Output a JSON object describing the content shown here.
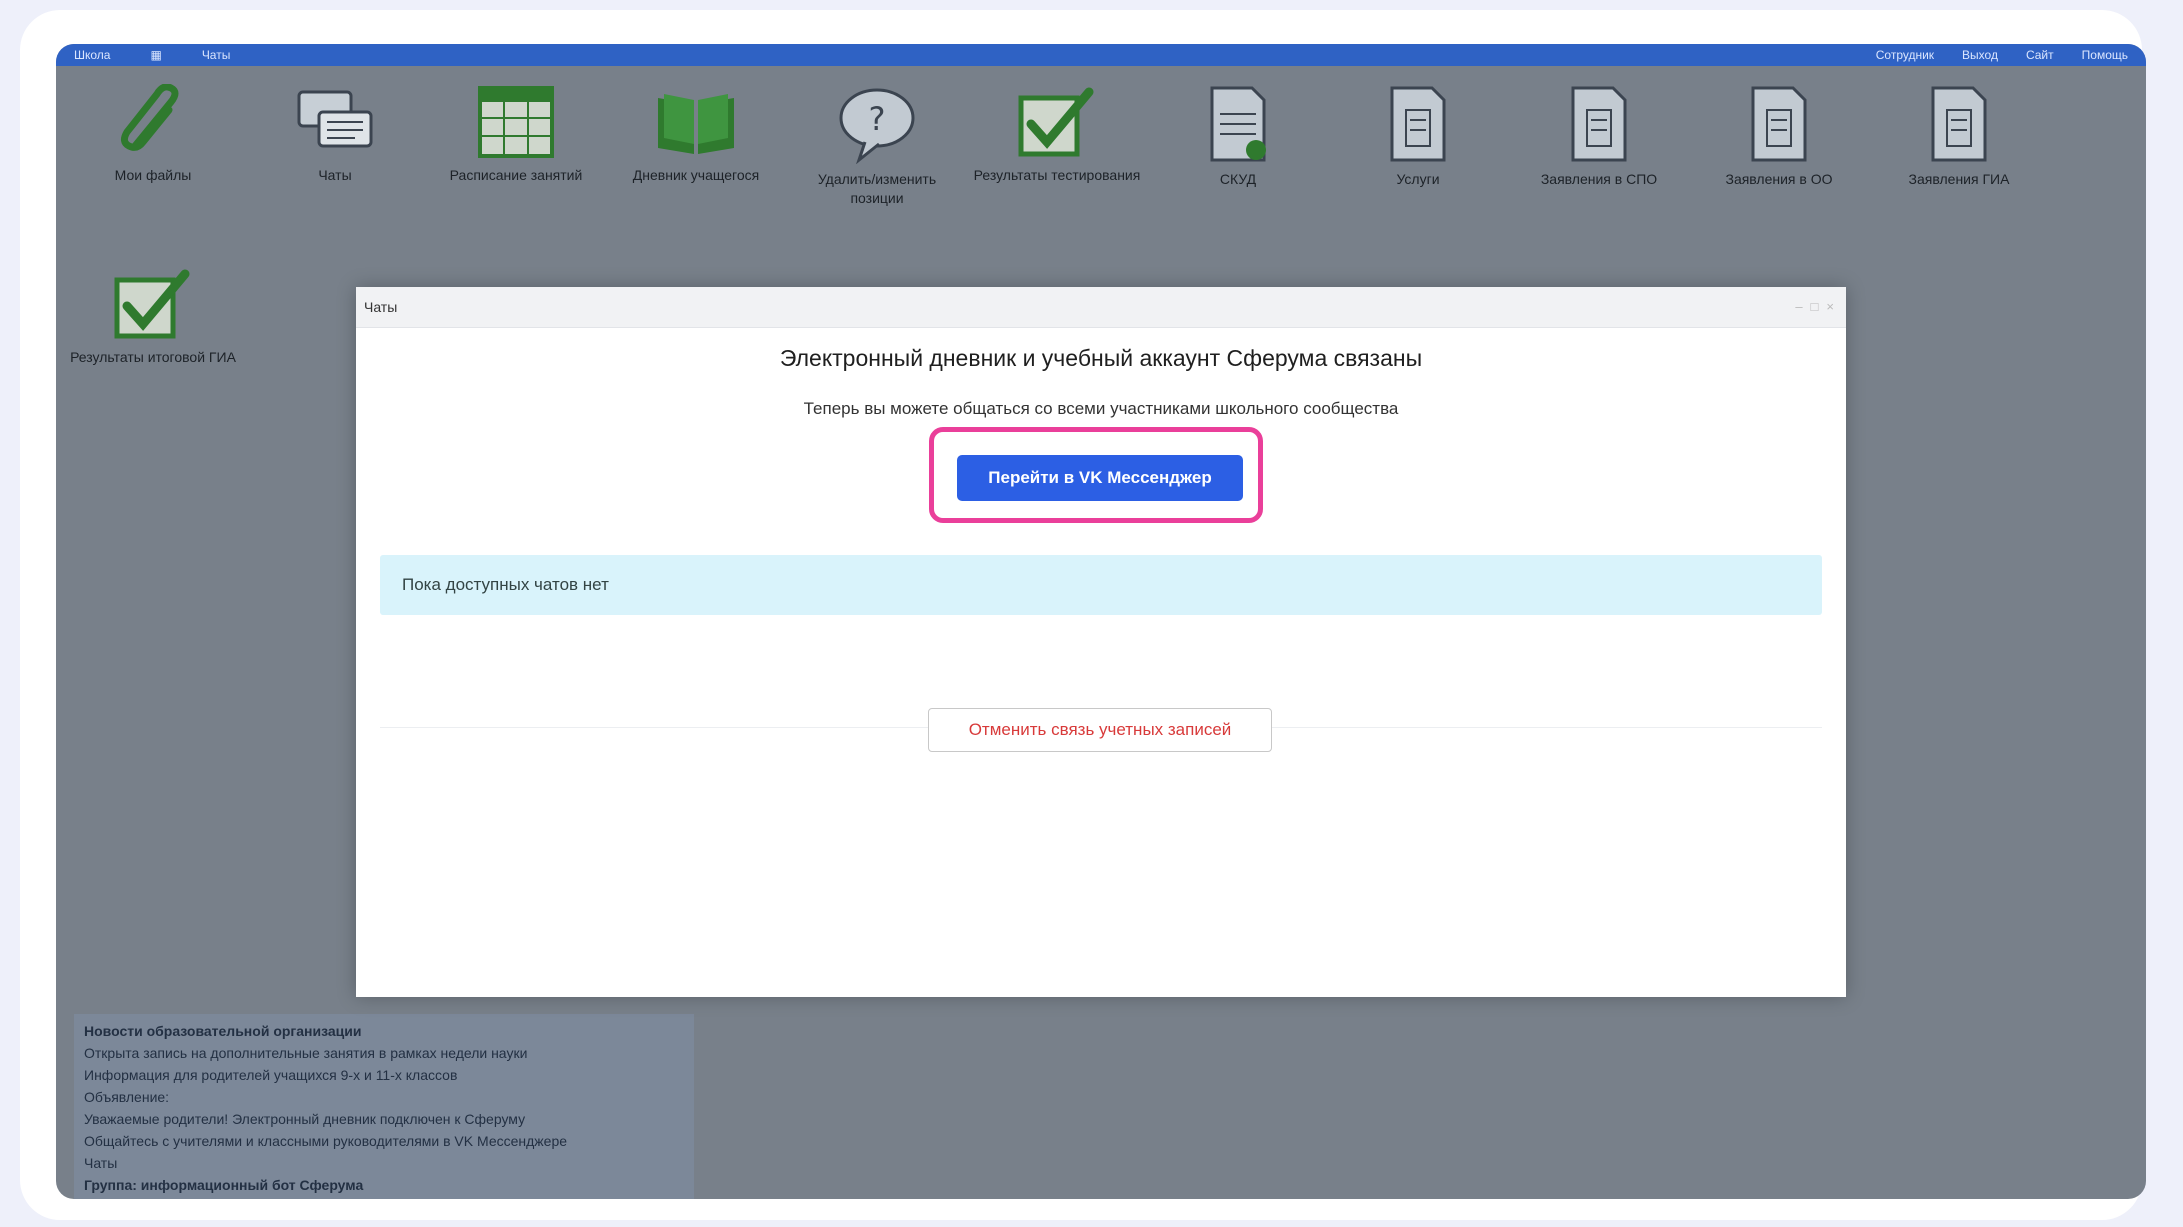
{
  "topbar": {
    "items_left": [
      "Школа",
      "▦",
      "Чаты"
    ],
    "items_right": [
      "Сотрудник",
      "Выход",
      "Сайт",
      "Помощь"
    ]
  },
  "desktop": {
    "icons": [
      {
        "label": "Мои файлы",
        "icon": "paperclip-icon"
      },
      {
        "label": "Чаты",
        "icon": "chat-icon"
      },
      {
        "label": "Расписание занятий",
        "icon": "calendar-icon"
      },
      {
        "label": "Дневник учащегося",
        "icon": "book-icon"
      },
      {
        "label": "Удалить/изменить позиции",
        "icon": "question-icon"
      },
      {
        "label": "Результаты тестирования",
        "icon": "checkbox-icon"
      },
      {
        "label": "СКУД",
        "icon": "document-icon"
      },
      {
        "label": "Услуги",
        "icon": "document-icon"
      },
      {
        "label": "Заявления в СПО",
        "icon": "document-icon"
      },
      {
        "label": "Заявления в ОО",
        "icon": "document-icon"
      },
      {
        "label": "Заявления ГИА",
        "icon": "document-icon"
      },
      {
        "label": "Результаты итоговой ГИА",
        "icon": "checkbox-icon"
      }
    ]
  },
  "news": {
    "lines": [
      "Новости образовательной организации",
      "Открыта запись на дополнительные занятия в рамках недели науки",
      "Информация для родителей учащихся 9-х и 11-х классов",
      "Объявление:",
      "Уважаемые родители! Электронный дневник подключен к Сферуму",
      "Общайтесь с учителями и классными руководителями в VK Мессенджере",
      "Чаты",
      "Группа: информационный бот Сферума"
    ]
  },
  "modal": {
    "title": "Чаты",
    "heading": "Электронный дневник и учебный аккаунт Сферума связаны",
    "subtitle": "Теперь вы можете общаться со всеми участниками школьного сообщества",
    "primary_button": "Перейти в VK Мессенджер",
    "info_text": "Пока доступных чатов нет",
    "unlink_button": "Отменить связь учетных записей"
  },
  "colors": {
    "accent": "#2c5fe4",
    "highlight": "#ea3f9a",
    "danger_text": "#d83a3a",
    "info_bg": "#d9f3fb"
  }
}
